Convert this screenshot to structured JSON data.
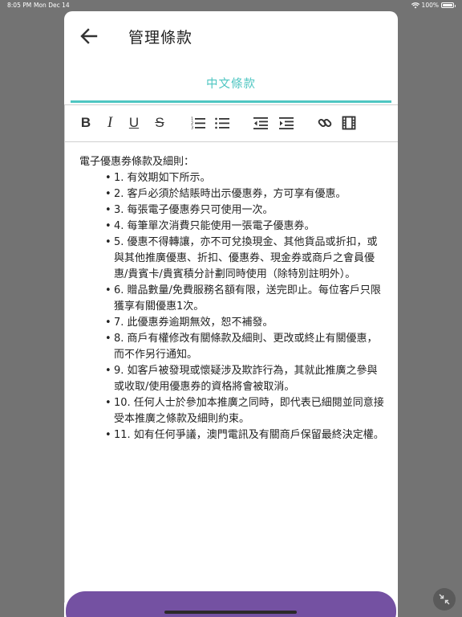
{
  "status_bar": {
    "time": "8:05 PM",
    "date": "Mon Dec 14",
    "battery": "100%",
    "wifi_icon": "wifi-icon",
    "battery_icon": "battery-icon"
  },
  "header": {
    "title": "管理條款",
    "back_icon": "arrow-left-icon"
  },
  "tabs": [
    {
      "label": "中文條款",
      "active": true
    }
  ],
  "toolbar": {
    "bold": "B",
    "italic": "I",
    "underline": "U",
    "strikethrough": "S",
    "icons": [
      "bold-icon",
      "italic-icon",
      "underline-icon",
      "strikethrough-icon",
      "ordered-list-icon",
      "bullet-list-icon",
      "outdent-icon",
      "indent-icon",
      "link-icon",
      "video-icon"
    ]
  },
  "content": {
    "title": "電子優惠劵條款及細則：",
    "items": [
      "1. 有效期如下所示。",
      "2. 客戶必須於結賬時出示優惠券，方可享有優惠。",
      "3. 每張電子優惠券只可使用一次。",
      "4. 每筆單次消費只能使用一張電子優惠券。",
      "5. 優惠不得轉讓，亦不可兌換現金、其他貨品或折扣，或與其他推廣優惠、折扣、優惠券、現金券或商戶之會員優惠/貴賓卡/貴賓積分計劃同時使用（除特別註明外）。",
      "6. 贈品數量/免費服務名額有限，送完即止。每位客戶只限獲享有關優惠1次。",
      "7. 此優惠券逾期無效，恕不補發。",
      "8. 商戶有權修改有關條款及細則、更改或終止有關優惠，而不作另行通知。",
      "9. 如客戶被發現或懷疑涉及欺詐行為，其就此推廣之參與或收取/使用優惠券的資格將會被取消。",
      "10. 任何人士於參加本推廣之同時，即代表已細閱並同意接受本推廣之條款及細則約束。",
      "11. 如有任何爭議，澳門電訊及有關商戶保留最終決定權。"
    ]
  },
  "colors": {
    "accent": "#4fc6c2",
    "primary_button": "#7451a2",
    "backdrop": "#737373"
  },
  "fab_icon": "collapse-icon"
}
